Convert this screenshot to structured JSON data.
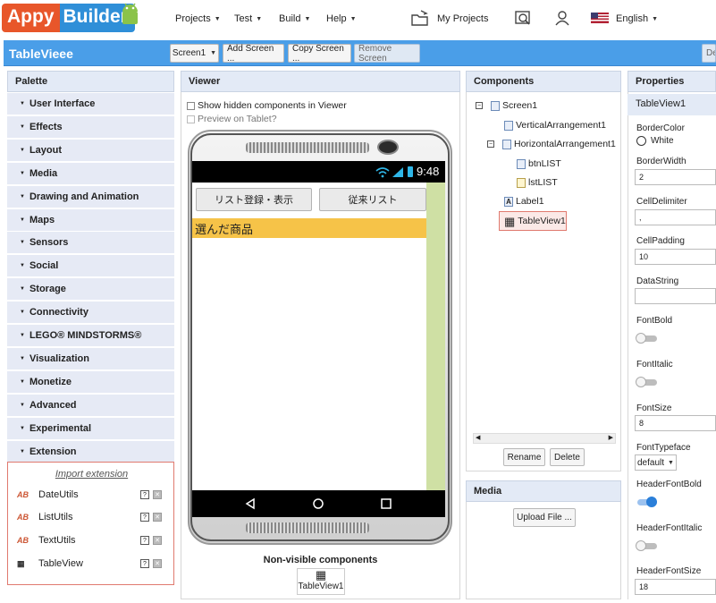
{
  "app": {
    "logo_part1": "Appy",
    "logo_part2": "Builder",
    "menus": [
      "Projects",
      "Test",
      "Build",
      "Help"
    ],
    "my_projects": "My Projects",
    "language": "English",
    "brand_blue": "#4a9ee8",
    "brand_orange": "#e8562a"
  },
  "toolbar": {
    "project_title": "TableVieee",
    "screen_select": "Screen1",
    "add_screen": "Add Screen ...",
    "copy_screen": "Copy Screen ...",
    "remove_screen": "Remove Screen",
    "overflow": "De"
  },
  "palette": {
    "title": "Palette",
    "categories": [
      "User Interface",
      "Effects",
      "Layout",
      "Media",
      "Drawing and Animation",
      "Maps",
      "Sensors",
      "Social",
      "Storage",
      "Connectivity",
      "LEGO® MINDSTORMS®",
      "Visualization",
      "Monetize",
      "Advanced",
      "Experimental",
      "Extension"
    ],
    "import_extension": "Import extension",
    "extensions": [
      {
        "name": "DateUtils",
        "icon": "ab-icon"
      },
      {
        "name": "ListUtils",
        "icon": "ab-icon"
      },
      {
        "name": "TextUtils",
        "icon": "ab-icon"
      },
      {
        "name": "TableView",
        "icon": "table-icon"
      }
    ]
  },
  "viewer": {
    "title": "Viewer",
    "show_hidden": "Show hidden components in Viewer",
    "preview_tablet": "Preview on Tablet?",
    "time": "9:48",
    "btn_list": "リスト登録・表示",
    "lst_list": "従来リスト",
    "label1_text": "選んだ商品",
    "nonvisible_title": "Non-visible components",
    "nonvisible_item": "TableView1"
  },
  "components": {
    "title": "Components",
    "tree": [
      {
        "name": "Screen1",
        "expander": "⊟"
      },
      {
        "name": "VerticalArrangement1",
        "expander": ""
      },
      {
        "name": "HorizontalArrangement1",
        "expander": "⊟"
      },
      {
        "name": "btnLIST",
        "expander": ""
      },
      {
        "name": "lstLIST",
        "expander": ""
      },
      {
        "name": "Label1",
        "expander": ""
      },
      {
        "name": "TableView1",
        "expander": ""
      }
    ],
    "rename": "Rename",
    "delete": "Delete"
  },
  "media": {
    "title": "Media",
    "upload": "Upload File ..."
  },
  "properties": {
    "title": "Properties",
    "component": "TableView1",
    "border_color_label": "BorderColor",
    "border_color_value": "White",
    "border_width_label": "BorderWidth",
    "border_width_value": "2",
    "cell_delimiter_label": "CellDelimiter",
    "cell_delimiter_value": ",",
    "cell_padding_label": "CellPadding",
    "cell_padding_value": "10",
    "data_string_label": "DataString",
    "font_bold_label": "FontBold",
    "font_italic_label": "FontItalic",
    "font_size_label": "FontSize",
    "font_size_value": "8",
    "font_typeface_label": "FontTypeface",
    "font_typeface_value": "default",
    "header_font_bold_label": "HeaderFontBold",
    "header_font_italic_label": "HeaderFontItalic",
    "header_font_size_label": "HeaderFontSize",
    "header_font_size_value": "18"
  }
}
